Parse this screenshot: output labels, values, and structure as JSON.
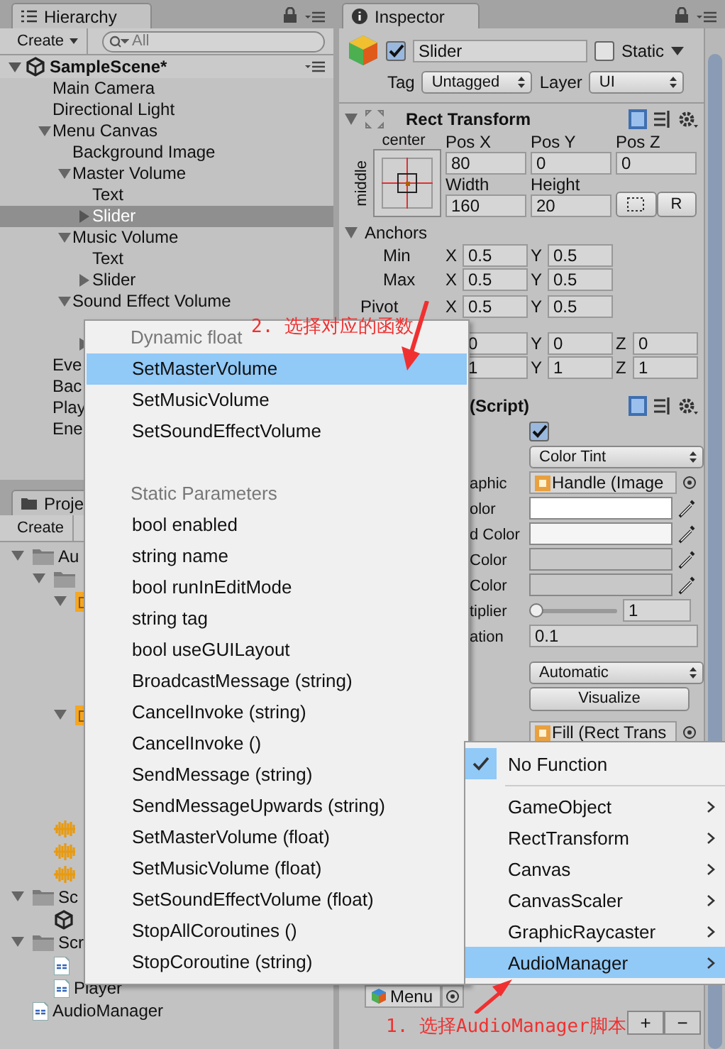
{
  "hierarchy": {
    "tab": "Hierarchy",
    "create": "Create",
    "search_placeholder": "All",
    "scene": "SampleScene*",
    "items": [
      {
        "label": "Main Camera",
        "selected": false
      },
      {
        "label": "Directional Light",
        "selected": false
      },
      {
        "label": "Menu Canvas",
        "selected": false,
        "expanded": true,
        "children": [
          {
            "label": "Background Image",
            "selected": false
          },
          {
            "label": "Master Volume",
            "selected": false,
            "expanded": true,
            "children": [
              {
                "label": "Text",
                "selected": false
              },
              {
                "label": "Slider",
                "selected": true,
                "expanded": false
              }
            ]
          },
          {
            "label": "Music Volume",
            "selected": false,
            "expanded": true,
            "children": [
              {
                "label": "Text",
                "selected": false
              },
              {
                "label": "Slider",
                "selected": false,
                "expanded": false
              }
            ]
          },
          {
            "label": "Sound Effect Volume",
            "selected": false,
            "expanded": true,
            "children": [
              {
                "expanded": false
              }
            ]
          }
        ]
      },
      {
        "label": "Eve",
        "selected": false
      },
      {
        "label": "Bac",
        "selected": false
      },
      {
        "label": "Play",
        "selected": false
      },
      {
        "label": "Ene",
        "selected": false
      }
    ]
  },
  "project": {
    "tab": "Proje",
    "create": "Create",
    "items": [
      {
        "kind": "folder",
        "label": "Au",
        "expanded": true,
        "children": [
          {
            "kind": "folder",
            "expanded": true,
            "children": [
              {
                "kind": "prefab",
                "expanded": true
              },
              {
                "kind": "prefab",
                "expanded": true
              }
            ]
          },
          {
            "kind": "audio"
          },
          {
            "kind": "audio"
          },
          {
            "kind": "audio"
          }
        ]
      },
      {
        "kind": "folder",
        "label": "Sc",
        "expanded": true,
        "children": [
          {
            "kind": "scene"
          }
        ]
      },
      {
        "kind": "folder",
        "label": "Scr",
        "expanded": true,
        "children": [
          {
            "kind": "script"
          },
          {
            "kind": "script",
            "label": "Player"
          }
        ]
      },
      {
        "kind": "script",
        "label": "AudioManager"
      }
    ]
  },
  "inspector": {
    "tab": "Inspector",
    "active": true,
    "name": "Slider",
    "static_label": "Static",
    "static": false,
    "tag_label": "Tag",
    "tag": "Untagged",
    "layer_label": "Layer",
    "layer": "UI",
    "rect_transform": {
      "title": "Rect Transform",
      "anchor_h": "center",
      "anchor_v": "middle",
      "fields": [
        {
          "label": "Pos X",
          "value": "80"
        },
        {
          "label": "Pos Y",
          "value": "0"
        },
        {
          "label": "Pos Z",
          "value": "0"
        },
        {
          "label": "Width",
          "value": "160"
        },
        {
          "label": "Height",
          "value": "20"
        }
      ],
      "r_button": "R",
      "anchors_label": "Anchors",
      "anchors_expanded": true,
      "rows": [
        {
          "label": "Min",
          "cells": [
            {
              "axis": "X",
              "value": "0.5"
            },
            {
              "axis": "Y",
              "value": "0.5"
            }
          ]
        },
        {
          "label": "Max",
          "cells": [
            {
              "axis": "X",
              "value": "0.5"
            },
            {
              "axis": "Y",
              "value": "0.5"
            }
          ]
        },
        {
          "label": "Pivot",
          "cells": [
            {
              "axis": "X",
              "value": "0.5"
            },
            {
              "axis": "Y",
              "value": "0.5"
            }
          ]
        },
        {
          "cells": [
            {
              "value": "0"
            },
            {
              "axis": "Y",
              "value": "0"
            },
            {
              "axis": "Z",
              "value": "0"
            }
          ]
        },
        {
          "cells": [
            {
              "value": "1"
            },
            {
              "axis": "Y",
              "value": "1"
            },
            {
              "axis": "Z",
              "value": "1"
            }
          ]
        }
      ]
    },
    "script": {
      "title": "(Script)",
      "enabled": true,
      "rows": [
        {
          "kind": "dropdown",
          "value": "Color Tint"
        },
        {
          "kind": "object",
          "label": "aphic",
          "value": "Handle (Image"
        },
        {
          "kind": "color",
          "label": "olor",
          "color": "#ffffff"
        },
        {
          "kind": "color",
          "label": "d Color",
          "color": "#f5f5f5"
        },
        {
          "kind": "color",
          "label": "Color",
          "color": "#c8c8c8"
        },
        {
          "kind": "color",
          "label": "Color",
          "color": "#c8c8c8"
        },
        {
          "kind": "slider",
          "label": "tiplier",
          "level": 0,
          "value": "1"
        },
        {
          "kind": "number",
          "label": "ation",
          "value": "0.1"
        },
        {
          "kind": "dropdown",
          "value": "Automatic"
        },
        {
          "kind": "button",
          "value": "Visualize"
        },
        {
          "kind": "object",
          "value": "Fill (Rect Trans"
        }
      ]
    },
    "on_click": {
      "object": "Menu",
      "add": "+",
      "remove": "−"
    }
  },
  "function_menu": {
    "sections": [
      {
        "header": "Dynamic float",
        "items": [
          {
            "label": "SetMasterVolume",
            "selected": true
          },
          {
            "label": "SetMusicVolume",
            "selected": false
          },
          {
            "label": "SetSoundEffectVolume",
            "selected": false
          }
        ]
      },
      {
        "header": "Static Parameters",
        "items": [
          {
            "label": "bool enabled",
            "selected": false
          },
          {
            "label": "string name",
            "selected": false
          },
          {
            "label": "bool runInEditMode",
            "selected": false
          },
          {
            "label": "string tag",
            "selected": false
          },
          {
            "label": "bool useGUILayout",
            "selected": false
          },
          {
            "label": "BroadcastMessage (string)",
            "selected": false
          },
          {
            "label": "CancelInvoke (string)",
            "selected": false
          },
          {
            "label": "CancelInvoke ()",
            "selected": false
          },
          {
            "label": "SendMessage (string)",
            "selected": false
          },
          {
            "label": "SendMessageUpwards (string)",
            "selected": false
          },
          {
            "label": "SetMasterVolume (float)",
            "selected": false
          },
          {
            "label": "SetMusicVolume (float)",
            "selected": false
          },
          {
            "label": "SetSoundEffectVolume (float)",
            "selected": false
          },
          {
            "label": "StopAllCoroutines ()",
            "selected": false
          },
          {
            "label": "StopCoroutine (string)",
            "selected": false
          }
        ]
      }
    ]
  },
  "component_menu": {
    "items": [
      {
        "label": "No Function",
        "checked": true,
        "submenu": false,
        "selected": false
      },
      {
        "label": "GameObject",
        "checked": false,
        "submenu": true,
        "selected": false
      },
      {
        "label": "RectTransform",
        "checked": false,
        "submenu": true,
        "selected": false
      },
      {
        "label": "Canvas",
        "checked": false,
        "submenu": true,
        "selected": false
      },
      {
        "label": "CanvasScaler",
        "checked": false,
        "submenu": true,
        "selected": false
      },
      {
        "label": "GraphicRaycaster",
        "checked": false,
        "submenu": true,
        "selected": false
      },
      {
        "label": "AudioManager",
        "checked": false,
        "submenu": true,
        "selected": true
      }
    ]
  },
  "annotations": [
    {
      "text": "2. 选择对应的函数"
    },
    {
      "text": "1. 选择AudioManager脚本"
    }
  ]
}
